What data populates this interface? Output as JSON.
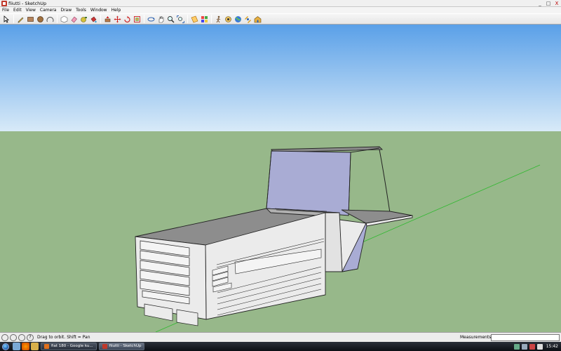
{
  "window": {
    "title": "fiiutti - SketchUp",
    "minimize": "_",
    "maximize": "□",
    "close": "X"
  },
  "menu": [
    "File",
    "Edit",
    "View",
    "Camera",
    "Draw",
    "Tools",
    "Window",
    "Help"
  ],
  "toolbar": {
    "tools": [
      "select-icon",
      "pencil-icon",
      "rectangle-icon",
      "circle-icon",
      "arc-icon",
      "eraser-icon",
      "paint-bucket-icon",
      "push-pull-icon",
      "move-icon",
      "rotate-icon",
      "offset-icon",
      "orbit-icon",
      "pan-icon",
      "zoom-icon",
      "zoom-extents-icon",
      "section-icon",
      "walk-icon",
      "look-around-icon",
      "google-earth-icon",
      "components-icon",
      "warehouse-icon"
    ]
  },
  "status": {
    "hint": "Drag to orbit.  Shift = Pan",
    "help_icon": "?",
    "measurements_label": "Measurements",
    "measurements_value": ""
  },
  "taskbar": {
    "tasks": [
      {
        "label": "fiat 180 - Google ku...",
        "active": false
      },
      {
        "label": "fiiutti - SketchUp",
        "active": true
      }
    ],
    "tray_lang": "",
    "clock": "15:42"
  },
  "colors": {
    "sky_top": "#5aa0e8",
    "sky_bottom": "#d8eaf8",
    "ground": "#97b88a",
    "model_face": "#ebebeb",
    "model_top": "#8d8d8d",
    "glass": "#a9acd4",
    "axis_green": "#2fb82f"
  }
}
